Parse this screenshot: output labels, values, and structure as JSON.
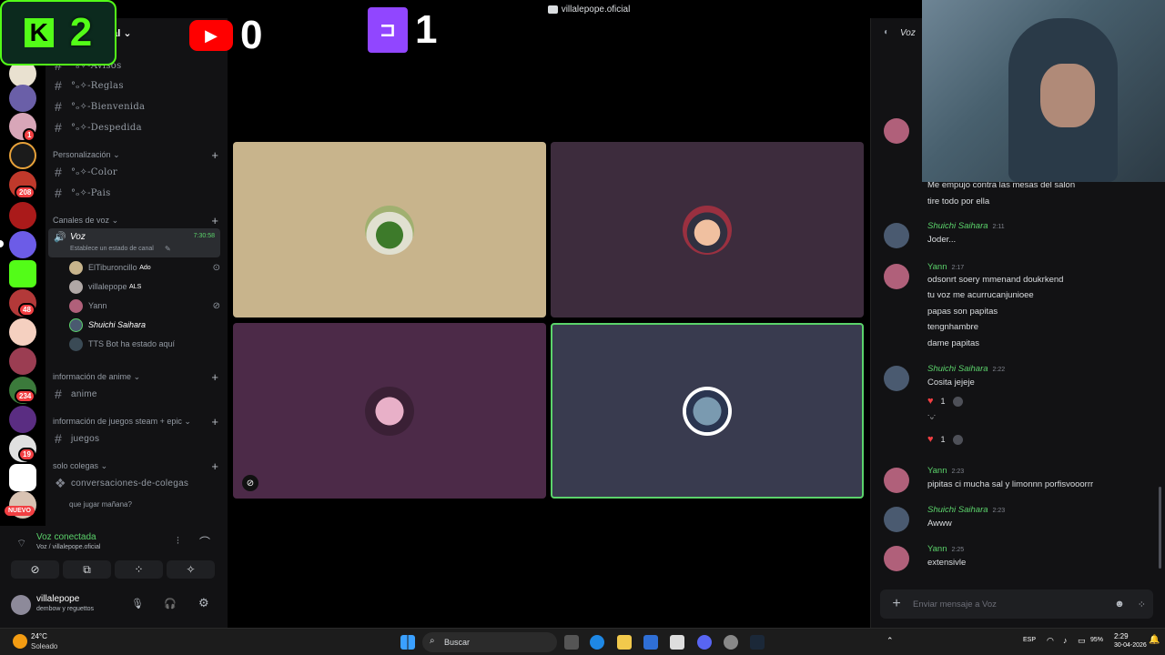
{
  "window": {
    "title": "villalepope.oficial"
  },
  "overlay": {
    "kick_count": "2",
    "youtube_count": "0",
    "twitch_count": "1"
  },
  "server_rail": {
    "badges": [
      "1",
      "208",
      "48",
      "234",
      "19"
    ],
    "nuevo": "NUEVO"
  },
  "server_header": {
    "name": "cial"
  },
  "channels": {
    "top": [
      {
        "name": "°ₒ✧-Avisos"
      },
      {
        "name": "°ₒ✧-Reglas"
      },
      {
        "name": "°ₒ✧-Bienvenida"
      },
      {
        "name": "°ₒ✧-Despedida"
      }
    ],
    "cat_personalizacion": "Personalización",
    "personalizacion": [
      {
        "name": "°ₒ✧-Color"
      },
      {
        "name": "°ₒ✧-Pais"
      }
    ],
    "cat_voz": "Canales de voz",
    "voice": {
      "name": "Voz",
      "timer": "7:30:58",
      "status": "Establece un estado de canal"
    },
    "voice_users": [
      {
        "name": "ElTiburoncillo",
        "tag": "Ado"
      },
      {
        "name": "villalepope",
        "tag": "ALS"
      },
      {
        "name": "Yann",
        "tag": ""
      },
      {
        "name": "Shuichi Saihara",
        "tag": ""
      },
      {
        "name": "TTS Bot ha estado aquí",
        "tag": ""
      }
    ],
    "cat_anime": "información de anime",
    "anime": "anime",
    "cat_juegos": "información de juegos steam + epic",
    "juegos": "juegos",
    "cat_solo": "solo colegas",
    "conversaciones": "conversaciones-de-colegas",
    "thread": "que jugar mañana?"
  },
  "voice_panel": {
    "status": "Voz conectada",
    "location": "Voz / villalepope.oficial"
  },
  "user_panel": {
    "name": "villalepope",
    "status": "dembow y reguettos"
  },
  "chat": {
    "header": "Voz",
    "partial_msg": "Me empujo contra las mesas del salon",
    "partial_msg2": "tire todo por ella",
    "messages": [
      {
        "user": "Shuichi Saihara",
        "time": "2:11",
        "lines": [
          "Joder..."
        ]
      },
      {
        "user": "Yann",
        "time": "2:17",
        "lines": [
          "odsonrt soery mmenand doukrkend",
          "tu voz me acurrucanjunioee",
          "papas son papitas",
          "tengnhambre",
          "dame papitas"
        ]
      },
      {
        "user": "Shuichi Saihara",
        "time": "2:22",
        "lines": [
          "Cosita jejeje"
        ],
        "extra": "˙ᵕ˙"
      },
      {
        "user": "Yann",
        "time": "2:23",
        "lines": [
          "pipitas ci mucha sal y limonnn porfisvooorrr"
        ]
      },
      {
        "user": "Shuichi Saihara",
        "time": "2:23",
        "lines": [
          "Awww"
        ]
      },
      {
        "user": "Yann",
        "time": "2:25",
        "lines": [
          "extensivle"
        ]
      }
    ],
    "reaction_count": "1",
    "input_placeholder": "Enviar mensaje a Voz"
  },
  "taskbar": {
    "weather_temp": "24°C",
    "weather_text": "Soleado",
    "search": "Buscar",
    "lang": "ESP",
    "battery": "95%",
    "time": "2:29",
    "date": "30-04-2026"
  },
  "colors": {
    "accent": "#5bd36b",
    "danger": "#f23f42",
    "tile_tan": "#c8b48c",
    "tile_plum": "#3d2c3d",
    "tile_purple": "#4c2a48",
    "tile_slate": "#393b4f"
  }
}
